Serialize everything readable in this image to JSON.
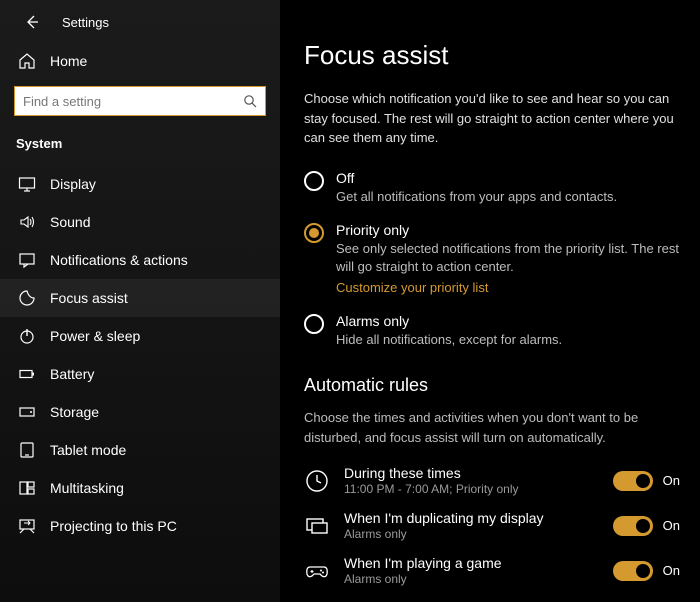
{
  "header": {
    "app_title": "Settings"
  },
  "sidebar": {
    "home_label": "Home",
    "search_placeholder": "Find a setting",
    "section_label": "System",
    "items": [
      {
        "label": "Display"
      },
      {
        "label": "Sound"
      },
      {
        "label": "Notifications & actions"
      },
      {
        "label": "Focus assist"
      },
      {
        "label": "Power & sleep"
      },
      {
        "label": "Battery"
      },
      {
        "label": "Storage"
      },
      {
        "label": "Tablet mode"
      },
      {
        "label": "Multitasking"
      },
      {
        "label": "Projecting to this PC"
      }
    ]
  },
  "main": {
    "title": "Focus assist",
    "description": "Choose which notification you'd like to see and hear so you can stay focused. The rest will go straight to action center where you can see them any time.",
    "radios": [
      {
        "title": "Off",
        "sub": "Get all notifications from your apps and contacts."
      },
      {
        "title": "Priority only",
        "sub": "See only selected notifications from the priority list. The rest will go straight to action center.",
        "link": "Customize your priority list"
      },
      {
        "title": "Alarms only",
        "sub": "Hide all notifications, except for alarms."
      }
    ],
    "auto_heading": "Automatic rules",
    "auto_desc": "Choose the times and activities when you don't want to be disturbed, and focus assist will turn on automatically.",
    "rules": [
      {
        "title": "During these times",
        "sub": "11:00 PM - 7:00 AM; Priority only",
        "state": "On"
      },
      {
        "title": "When I'm duplicating my display",
        "sub": "Alarms only",
        "state": "On"
      },
      {
        "title": "When I'm playing a game",
        "sub": "Alarms only",
        "state": "On"
      }
    ]
  }
}
